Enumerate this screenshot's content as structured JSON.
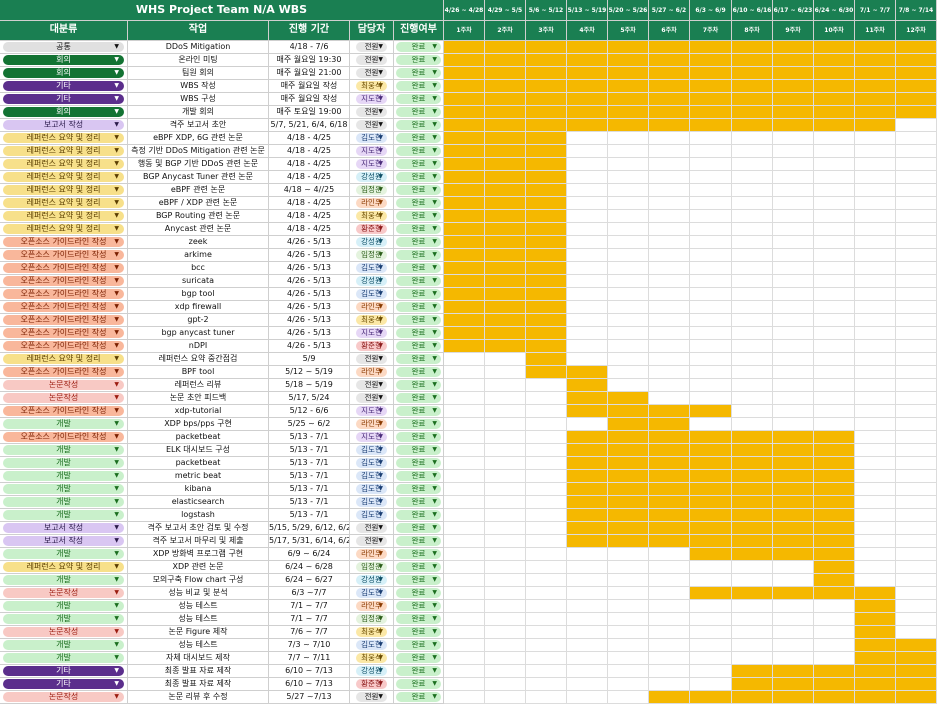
{
  "sheet": {
    "title": "WHS Project Team N/A WBS",
    "columns": [
      "대분류",
      "작업",
      "진행 기간",
      "담당자",
      "진행여부"
    ],
    "weeks": [
      {
        "range": "4/26 ~ 4/28",
        "label": "1주차"
      },
      {
        "range": "4/29 ~ 5/5",
        "label": "2주차"
      },
      {
        "range": "5/6 ~ 5/12",
        "label": "3주차"
      },
      {
        "range": "5/13 ~ 5/19",
        "label": "4주차"
      },
      {
        "range": "5/20 ~ 5/26",
        "label": "5주차"
      },
      {
        "range": "5/27 ~ 6/2",
        "label": "6주차"
      },
      {
        "range": "6/3 ~ 6/9",
        "label": "7주차"
      },
      {
        "range": "6/10 ~ 6/16",
        "label": "8주차"
      },
      {
        "range": "6/17 ~ 6/23",
        "label": "9주차"
      },
      {
        "range": "6/24 ~ 6/30",
        "label": "10주차"
      },
      {
        "range": "7/1 ~ 7/7",
        "label": "11주차"
      },
      {
        "range": "7/8 ~ 7/14",
        "label": "12주차"
      }
    ]
  },
  "categories": {
    "공통": {
      "bg": "#e0e0e0",
      "fg": "#111111"
    },
    "회의": {
      "bg": "#137333",
      "fg": "#ffffff"
    },
    "기타": {
      "bg": "#5b2e8c",
      "fg": "#ffffff"
    },
    "보고서 작성": {
      "bg": "#d9c6f2",
      "fg": "#2a1a4a"
    },
    "레퍼런스 요약 및 정리": {
      "bg": "#f7e08a",
      "fg": "#5a3d00"
    },
    "오픈소스 가이드라인 작성": {
      "bg": "#f9b79b",
      "fg": "#7a1f00"
    },
    "논문작성": {
      "bg": "#f8c9c4",
      "fg": "#9b1c10"
    },
    "개발": {
      "bg": "#c9f0cb",
      "fg": "#1b6e1f"
    }
  },
  "people": {
    "전원": {
      "bg": "#e6e6e6",
      "fg": "#111111"
    },
    "최웅식": {
      "bg": "#fbe8a6",
      "fg": "#6a4b00"
    },
    "지도현": {
      "bg": "#e6d7f6",
      "fg": "#4a2c7a"
    },
    "김도현": {
      "bg": "#dbe7f8",
      "fg": "#1a3e73"
    },
    "강성원": {
      "bg": "#d6f0f8",
      "fg": "#0e4f66"
    },
    "임정운": {
      "bg": "#e4f3de",
      "fg": "#2c5e1a"
    },
    "라인우": {
      "bg": "#fcd9c3",
      "fg": "#8a3a00"
    },
    "황준형": {
      "bg": "#f8c9c9",
      "fg": "#8c1a1a"
    }
  },
  "status_label": "완료",
  "gantt_color": "#f5b800",
  "rows": [
    {
      "cat": "공통",
      "task": "DDoS Mitigation",
      "period": "4/18 - 7/6",
      "owner": "전원",
      "status": "완료",
      "weeks": [
        1,
        2,
        3,
        4,
        5,
        6,
        7,
        8,
        9,
        10,
        11,
        12
      ]
    },
    {
      "cat": "회의",
      "task": "온라인 미팅",
      "period": "매주 월요일 19:30",
      "owner": "전원",
      "status": "완료",
      "weeks": [
        1,
        2,
        3,
        4,
        5,
        6,
        7,
        8,
        9,
        10,
        11,
        12
      ]
    },
    {
      "cat": "회의",
      "task": "팀원 회의",
      "period": "매주 월요일 21:00",
      "owner": "전원",
      "status": "완료",
      "weeks": [
        1,
        2,
        3,
        4,
        5,
        6,
        7,
        8,
        9,
        10,
        11,
        12
      ]
    },
    {
      "cat": "기타",
      "task": "WBS 작성",
      "period": "매주 월요일 작성",
      "owner": "최웅식",
      "status": "완료",
      "weeks": [
        1,
        2,
        3,
        4,
        5,
        6,
        7,
        8,
        9,
        10,
        11,
        12
      ]
    },
    {
      "cat": "기타",
      "task": "WBS 구성",
      "period": "매주 월요일 작성",
      "owner": "지도현",
      "status": "완료",
      "weeks": [
        1,
        2,
        3,
        4,
        5,
        6,
        7,
        8,
        9,
        10,
        11,
        12
      ]
    },
    {
      "cat": "회의",
      "task": "개발 회의",
      "period": "매주 토요일 19:00",
      "owner": "전원",
      "status": "완료",
      "weeks": [
        1,
        2,
        3,
        4,
        5,
        6,
        7,
        8,
        9,
        10,
        11,
        12
      ]
    },
    {
      "cat": "보고서 작성",
      "task": "격주 보고서 초안",
      "period": "5/7, 5/21, 6/4, 6/18",
      "owner": "전원",
      "status": "완료",
      "weeks": [
        1,
        2,
        3,
        4,
        5,
        6,
        7,
        8,
        9,
        10,
        11
      ]
    },
    {
      "cat": "레퍼런스 요약 및 정리",
      "task": "eBPF XDP, 6G 관련 논문",
      "period": "4/18 - 4/25",
      "owner": "김도현",
      "status": "완료",
      "weeks": [
        1,
        2,
        3
      ]
    },
    {
      "cat": "레퍼런스 요약 및 정리",
      "task": "측정 기반 DDoS Mitigation 관련 논문",
      "period": "4/18 - 4/25",
      "owner": "지도현",
      "status": "완료",
      "weeks": [
        1,
        2,
        3
      ]
    },
    {
      "cat": "레퍼런스 요약 및 정리",
      "task": "행동 및 BGP 기반 DDoS 관련 논문",
      "period": "4/18 - 4/25",
      "owner": "지도현",
      "status": "완료",
      "weeks": [
        1,
        2,
        3
      ]
    },
    {
      "cat": "레퍼런스 요약 및 정리",
      "task": "BGP Anycast Tuner 관련 논문",
      "period": "4/18 - 4/25",
      "owner": "강성원",
      "status": "완료",
      "weeks": [
        1,
        2,
        3
      ]
    },
    {
      "cat": "레퍼런스 요약 및 정리",
      "task": "eBPF 관련 논문",
      "period": "4/18 ~ 4//25",
      "owner": "임정운",
      "status": "완료",
      "weeks": [
        1,
        2,
        3
      ]
    },
    {
      "cat": "레퍼런스 요약 및 정리",
      "task": "eBPF / XDP 관련 논문",
      "period": "4/18 - 4/25",
      "owner": "라인우",
      "status": "완료",
      "weeks": [
        1,
        2,
        3
      ]
    },
    {
      "cat": "레퍼런스 요약 및 정리",
      "task": "BGP Routing 관련 논문",
      "period": "4/18 - 4/25",
      "owner": "최웅식",
      "status": "완료",
      "weeks": [
        1,
        2,
        3
      ]
    },
    {
      "cat": "레퍼런스 요약 및 정리",
      "task": "Anycast 관련 논문",
      "period": "4/18 - 4/25",
      "owner": "황준형",
      "status": "완료",
      "weeks": [
        1,
        2,
        3
      ]
    },
    {
      "cat": "오픈소스 가이드라인 작성",
      "task": "zeek",
      "period": "4/26 - 5/13",
      "owner": "강성원",
      "status": "완료",
      "weeks": [
        1,
        2,
        3
      ]
    },
    {
      "cat": "오픈소스 가이드라인 작성",
      "task": "arkime",
      "period": "4/26 - 5/13",
      "owner": "임정운",
      "status": "완료",
      "weeks": [
        1,
        2,
        3
      ]
    },
    {
      "cat": "오픈소스 가이드라인 작성",
      "task": "bcc",
      "period": "4/26 - 5/13",
      "owner": "김도현",
      "status": "완료",
      "weeks": [
        1,
        2,
        3
      ]
    },
    {
      "cat": "오픈소스 가이드라인 작성",
      "task": "suricata",
      "period": "4/26 - 5/13",
      "owner": "강성원",
      "status": "완료",
      "weeks": [
        1,
        2,
        3
      ]
    },
    {
      "cat": "오픈소스 가이드라인 작성",
      "task": "bgp tool",
      "period": "4/26 - 5/13",
      "owner": "김도현",
      "status": "완료",
      "weeks": [
        1,
        2,
        3
      ]
    },
    {
      "cat": "오픈소스 가이드라인 작성",
      "task": "xdp firewall",
      "period": "4/26 - 5/13",
      "owner": "라인우",
      "status": "완료",
      "weeks": [
        1,
        2,
        3
      ]
    },
    {
      "cat": "오픈소스 가이드라인 작성",
      "task": "gpt-2",
      "period": "4/26 - 5/13",
      "owner": "최웅식",
      "status": "완료",
      "weeks": [
        1,
        2,
        3
      ]
    },
    {
      "cat": "오픈소스 가이드라인 작성",
      "task": "bgp anycast tuner",
      "period": "4/26 - 5/13",
      "owner": "지도현",
      "status": "완료",
      "weeks": [
        1,
        2,
        3
      ]
    },
    {
      "cat": "오픈소스 가이드라인 작성",
      "task": "nDPI",
      "period": "4/26 - 5/13",
      "owner": "황준형",
      "status": "완료",
      "weeks": [
        1,
        2,
        3
      ]
    },
    {
      "cat": "레퍼런스 요약 및 정리",
      "task": "레퍼런스 요약 중간점검",
      "period": "5/9",
      "owner": "전원",
      "status": "완료",
      "weeks": [
        3
      ]
    },
    {
      "cat": "오픈소스 가이드라인 작성",
      "task": "BPF tool",
      "period": "5/12 ~ 5/19",
      "owner": "라인우",
      "status": "완료",
      "weeks": [
        3,
        4
      ]
    },
    {
      "cat": "논문작성",
      "task": "레퍼런스 리뷰",
      "period": "5/18 ~ 5/19",
      "owner": "전원",
      "status": "완료",
      "weeks": [
        4
      ]
    },
    {
      "cat": "논문작성",
      "task": "논문 초안 피드백",
      "period": "5/17, 5/24",
      "owner": "전원",
      "status": "완료",
      "weeks": [
        4,
        5
      ]
    },
    {
      "cat": "오픈소스 가이드라인 작성",
      "task": "xdp-tutorial",
      "period": "5/12 - 6/6",
      "owner": "지도현",
      "status": "완료",
      "weeks": [
        4,
        5,
        6,
        7
      ]
    },
    {
      "cat": "개발",
      "task": "XDP bps/pps 구현",
      "period": "5/25 ~ 6/2",
      "owner": "라인우",
      "status": "완료",
      "weeks": [
        5,
        6
      ]
    },
    {
      "cat": "오픈소스 가이드라인 작성",
      "task": "packetbeat",
      "period": "5/13 - 7/1",
      "owner": "지도현",
      "status": "완료",
      "weeks": [
        4,
        5,
        6,
        7,
        8,
        9,
        10
      ]
    },
    {
      "cat": "개발",
      "task": "ELK 대시보드 구성",
      "period": "5/13 - 7/1",
      "owner": "김도현",
      "status": "완료",
      "weeks": [
        4,
        5,
        6,
        7,
        8,
        9,
        10
      ]
    },
    {
      "cat": "개발",
      "task": "packetbeat",
      "period": "5/13 - 7/1",
      "owner": "김도현",
      "status": "완료",
      "weeks": [
        4,
        5,
        6,
        7,
        8,
        9,
        10
      ]
    },
    {
      "cat": "개발",
      "task": "metric beat",
      "period": "5/13 - 7/1",
      "owner": "김도현",
      "status": "완료",
      "weeks": [
        4,
        5,
        6,
        7,
        8,
        9,
        10
      ]
    },
    {
      "cat": "개발",
      "task": "kibana",
      "period": "5/13 - 7/1",
      "owner": "김도현",
      "status": "완료",
      "weeks": [
        4,
        5,
        6,
        7,
        8,
        9,
        10
      ]
    },
    {
      "cat": "개발",
      "task": "elasticsearch",
      "period": "5/13 - 7/1",
      "owner": "김도현",
      "status": "완료",
      "weeks": [
        4,
        5,
        6,
        7,
        8,
        9,
        10
      ]
    },
    {
      "cat": "개발",
      "task": "logstash",
      "period": "5/13 - 7/1",
      "owner": "김도현",
      "status": "완료",
      "weeks": [
        4,
        5,
        6,
        7,
        8,
        9,
        10
      ]
    },
    {
      "cat": "보고서 작성",
      "task": "격주 보고서 초안 검토 및 수정",
      "period": "5/15, 5/29, 6/12, 6/26",
      "owner": "전원",
      "status": "완료",
      "weeks": [
        4,
        5,
        6,
        7,
        8,
        9,
        10
      ]
    },
    {
      "cat": "보고서 작성",
      "task": "격주 보고서 마무리 및 제출",
      "period": "5/17, 5/31, 6/14, 6/28",
      "owner": "전원",
      "status": "완료",
      "weeks": [
        4,
        5,
        6,
        7,
        8,
        9,
        10
      ]
    },
    {
      "cat": "개발",
      "task": "XDP 방화벽 프로그램 구현",
      "period": "6/9 ~ 6/24",
      "owner": "라인우",
      "status": "완료",
      "weeks": [
        7,
        8,
        9,
        10
      ]
    },
    {
      "cat": "레퍼런스 요약 및 정리",
      "task": "XDP 관련 논문",
      "period": "6/24 ~ 6/28",
      "owner": "임정운",
      "status": "완료",
      "weeks": [
        10
      ]
    },
    {
      "cat": "개발",
      "task": "모의구축 Flow chart 구성",
      "period": "6/24 ~ 6/27",
      "owner": "강성원",
      "status": "완료",
      "weeks": [
        10
      ]
    },
    {
      "cat": "논문작성",
      "task": "성능 비교 및 분석",
      "period": "6/3 ~7/7",
      "owner": "김도현",
      "status": "완료",
      "weeks": [
        7,
        8,
        9,
        10,
        11
      ]
    },
    {
      "cat": "개발",
      "task": "성능 테스트",
      "period": "7/1 ~ 7/7",
      "owner": "라인우",
      "status": "완료",
      "weeks": [
        11
      ]
    },
    {
      "cat": "개발",
      "task": "성능 테스트",
      "period": "7/1 ~ 7/7",
      "owner": "임정운",
      "status": "완료",
      "weeks": [
        11
      ]
    },
    {
      "cat": "논문작성",
      "task": "논문 Figure 제작",
      "period": "7/6 ~ 7/7",
      "owner": "최웅식",
      "status": "완료",
      "weeks": [
        11
      ]
    },
    {
      "cat": "개발",
      "task": "성능 테스트",
      "period": "7/3 ~ 7/10",
      "owner": "김도현",
      "status": "완료",
      "weeks": [
        11,
        12
      ]
    },
    {
      "cat": "개발",
      "task": "자체 대시보드 제작",
      "period": "7/7 ~ 7/11",
      "owner": "최웅식",
      "status": "완료",
      "weeks": [
        11,
        12
      ]
    },
    {
      "cat": "기타",
      "task": "최종 발표 자료 제작",
      "period": "6/10 ~ 7/13",
      "owner": "강성원",
      "status": "완료",
      "weeks": [
        8,
        9,
        10,
        11,
        12
      ]
    },
    {
      "cat": "기타",
      "task": "최종 발표 자료 제작",
      "period": "6/10 ~ 7/13",
      "owner": "황준형",
      "status": "완료",
      "weeks": [
        8,
        9,
        10,
        11,
        12
      ]
    },
    {
      "cat": "논문작성",
      "task": "논문 리뷰 후 수정",
      "period": "5/27 ~7/13",
      "owner": "전원",
      "status": "완료",
      "weeks": [
        6,
        7,
        8,
        9,
        10,
        11,
        12
      ]
    }
  ]
}
